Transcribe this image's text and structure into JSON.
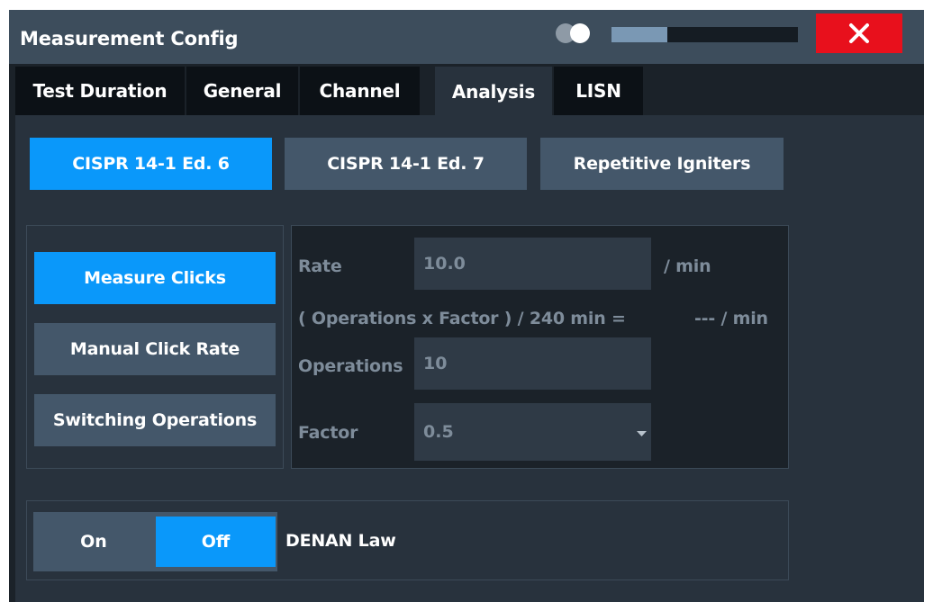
{
  "window": {
    "title": "Measurement Config",
    "progress_fraction": 0.3
  },
  "tabs": [
    {
      "label": "Test Duration",
      "active": false
    },
    {
      "label": "General",
      "active": false
    },
    {
      "label": "Channel",
      "active": false
    },
    {
      "label": "Analysis",
      "active": true
    },
    {
      "label": "LISN",
      "active": false
    }
  ],
  "standards": [
    {
      "label": "CISPR 14-1 Ed. 6",
      "selected": true
    },
    {
      "label": "CISPR 14-1 Ed. 7",
      "selected": false
    },
    {
      "label": "Repetitive Igniters",
      "selected": false
    }
  ],
  "modes": [
    {
      "label": "Measure Clicks",
      "selected": true
    },
    {
      "label": "Manual Click Rate",
      "selected": false
    },
    {
      "label": "Switching Operations",
      "selected": false
    }
  ],
  "rate": {
    "label": "Rate",
    "value": "10.0",
    "unit": "/ min"
  },
  "formula": {
    "text": "( Operations x Factor ) / 240 min =",
    "result": "--- / min"
  },
  "operations": {
    "label": "Operations",
    "value": "10"
  },
  "factor": {
    "label": "Factor",
    "value": "0.5"
  },
  "denan": {
    "on_label": "On",
    "off_label": "Off",
    "label": "DENAN Law",
    "state": "Off"
  },
  "colors": {
    "accent": "#0a98fa",
    "close": "#e8101c",
    "titlebar": "#3d4d5c",
    "panel": "#28323d"
  },
  "icons": {
    "close": "close-icon",
    "toggle": "toggle-icon",
    "dropdown": "chevron-down-icon"
  }
}
